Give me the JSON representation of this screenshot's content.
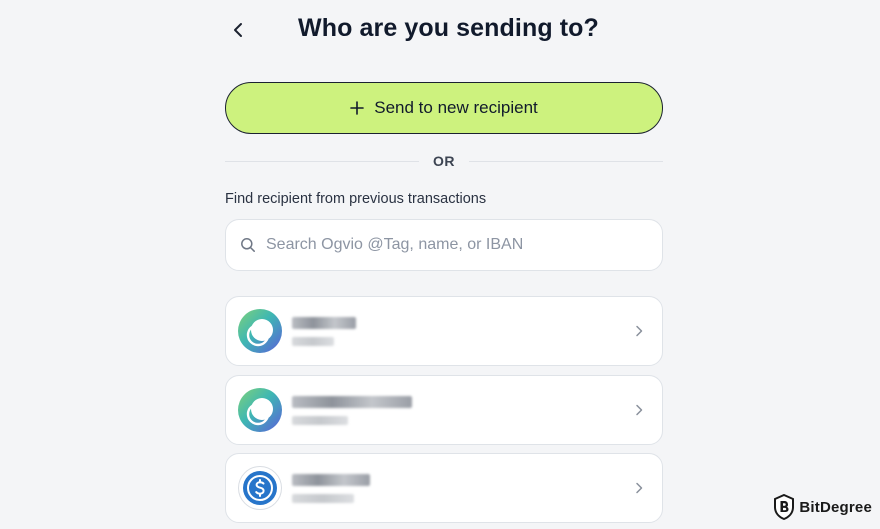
{
  "header": {
    "back_icon": "chevron-left-icon",
    "title": "Who are you sending to?"
  },
  "send_new": {
    "icon": "plus-icon",
    "label": "Send to new recipient",
    "color": "#cdf27e"
  },
  "divider": {
    "label": "OR"
  },
  "find": {
    "label": "Find recipient from previous transactions",
    "placeholder": "Search Ogvio @Tag, name, or IBAN",
    "value": ""
  },
  "recipients": [
    {
      "avatar": "ogvio-logo-icon"
    },
    {
      "avatar": "ogvio-logo-icon"
    },
    {
      "avatar": "usdc-icon"
    }
  ],
  "watermark": {
    "brand": "BitDegree",
    "icon": "bitdegree-shield-icon"
  }
}
